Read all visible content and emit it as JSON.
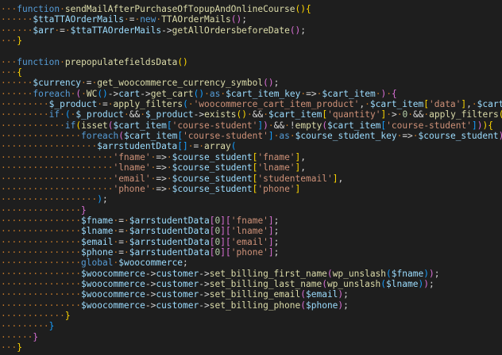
{
  "editor": {
    "lines": [
      [
        [
          "ws",
          "···"
        ],
        [
          "kw",
          "function"
        ],
        [
          "ws",
          "·"
        ],
        [
          "fn",
          "sendMailAfterPurchaseOfTopupAndOnlineCourse"
        ],
        [
          "p1",
          "(){"
        ]
      ],
      [
        [
          "ws",
          "······"
        ],
        [
          "var",
          "$ttaTTAOrderMails"
        ],
        [
          "ws",
          "·"
        ],
        [
          "op",
          "="
        ],
        [
          "ws",
          "·"
        ],
        [
          "kw",
          "new"
        ],
        [
          "ws",
          "·"
        ],
        [
          "fn",
          "TTAOrderMails"
        ],
        [
          "p2",
          "()"
        ],
        [
          "punc",
          ";"
        ]
      ],
      [
        [
          "ws",
          "······"
        ],
        [
          "var",
          "$arr"
        ],
        [
          "ws",
          "·"
        ],
        [
          "op",
          "="
        ],
        [
          "ws",
          "·"
        ],
        [
          "var",
          "$ttaTTAOrderMails"
        ],
        [
          "op",
          "->"
        ],
        [
          "fn",
          "getAllOrdersbeforeDate"
        ],
        [
          "p2",
          "()"
        ],
        [
          "punc",
          ";"
        ]
      ],
      [
        [
          "ws",
          "···"
        ],
        [
          "p1",
          "}"
        ]
      ],
      [
        [
          "ws",
          ""
        ]
      ],
      [
        [
          "ws",
          "···"
        ],
        [
          "kw",
          "function"
        ],
        [
          "ws",
          "·"
        ],
        [
          "fn",
          "prepopulatefieldsData"
        ],
        [
          "p1",
          "()"
        ]
      ],
      [
        [
          "ws",
          "···"
        ],
        [
          "p1",
          "{"
        ]
      ],
      [
        [
          "ws",
          "······"
        ],
        [
          "var",
          "$currency"
        ],
        [
          "ws",
          "·"
        ],
        [
          "op",
          "="
        ],
        [
          "ws",
          "·"
        ],
        [
          "fn",
          "get_woocommerce_currency_symbol"
        ],
        [
          "p2",
          "()"
        ],
        [
          "punc",
          ";"
        ]
      ],
      [
        [
          "ws",
          "······"
        ],
        [
          "kw",
          "foreach"
        ],
        [
          "ws",
          "·"
        ],
        [
          "p2",
          "("
        ],
        [
          "ws",
          "·"
        ],
        [
          "fn",
          "WC"
        ],
        [
          "p3",
          "()"
        ],
        [
          "op",
          "->"
        ],
        [
          "var",
          "cart"
        ],
        [
          "op",
          "->"
        ],
        [
          "fn",
          "get_cart"
        ],
        [
          "p3",
          "()"
        ],
        [
          "ws",
          "·"
        ],
        [
          "kw",
          "as"
        ],
        [
          "ws",
          "·"
        ],
        [
          "var",
          "$cart_item_key"
        ],
        [
          "ws",
          "·"
        ],
        [
          "op",
          "=>"
        ],
        [
          "ws",
          "·"
        ],
        [
          "var",
          "$cart_item"
        ],
        [
          "ws",
          "·"
        ],
        [
          "p2",
          ")"
        ],
        [
          "ws",
          "·"
        ],
        [
          "p2",
          "{"
        ]
      ],
      [
        [
          "ws",
          "·········"
        ],
        [
          "var",
          "$_product"
        ],
        [
          "ws",
          "·"
        ],
        [
          "op",
          "="
        ],
        [
          "ws",
          "·"
        ],
        [
          "fn",
          "apply_filters"
        ],
        [
          "p3",
          "("
        ],
        [
          "ws",
          "·"
        ],
        [
          "str",
          "'woocommerce_cart_item_product'"
        ],
        [
          "punc",
          ","
        ],
        [
          "ws",
          "·"
        ],
        [
          "var",
          "$cart_item"
        ],
        [
          "p1",
          "["
        ],
        [
          "str",
          "'data'"
        ],
        [
          "p1",
          "]"
        ],
        [
          "punc",
          ","
        ],
        [
          "ws",
          "·"
        ],
        [
          "var",
          "$cart_item"
        ],
        [
          "punc",
          ","
        ],
        [
          "ws",
          "·"
        ],
        [
          "var",
          "$cart"
        ]
      ],
      [
        [
          "ws",
          "·········"
        ],
        [
          "kw",
          "if"
        ],
        [
          "ws",
          "·"
        ],
        [
          "p3",
          "("
        ],
        [
          "ws",
          "·"
        ],
        [
          "var",
          "$_product"
        ],
        [
          "ws",
          "·"
        ],
        [
          "op",
          "&&"
        ],
        [
          "ws",
          "·"
        ],
        [
          "var",
          "$_product"
        ],
        [
          "op",
          "->"
        ],
        [
          "fn",
          "exists"
        ],
        [
          "p1",
          "()"
        ],
        [
          "ws",
          "·"
        ],
        [
          "op",
          "&&"
        ],
        [
          "ws",
          "·"
        ],
        [
          "var",
          "$cart_item"
        ],
        [
          "p1",
          "["
        ],
        [
          "str",
          "'quantity'"
        ],
        [
          "p1",
          "]"
        ],
        [
          "ws",
          "·"
        ],
        [
          "op",
          ">"
        ],
        [
          "ws",
          "·"
        ],
        [
          "num",
          "0"
        ],
        [
          "ws",
          "·"
        ],
        [
          "op",
          "&&"
        ],
        [
          "ws",
          "·"
        ],
        [
          "fn",
          "apply_filters"
        ],
        [
          "p1",
          "("
        ],
        [
          "ws",
          "·"
        ],
        [
          "str",
          "'woocommerce"
        ]
      ],
      [
        [
          "ws",
          "············"
        ],
        [
          "kw",
          "if"
        ],
        [
          "p1",
          "("
        ],
        [
          "fn",
          "isset"
        ],
        [
          "p2",
          "("
        ],
        [
          "var",
          "$cart_item"
        ],
        [
          "p3",
          "["
        ],
        [
          "str",
          "'course-student'"
        ],
        [
          "p3",
          "]"
        ],
        [
          "p2",
          ")"
        ],
        [
          "ws",
          "·"
        ],
        [
          "op",
          "&&"
        ],
        [
          "ws",
          "·"
        ],
        [
          "op",
          "!"
        ],
        [
          "fn",
          "empty"
        ],
        [
          "p2",
          "("
        ],
        [
          "var",
          "$cart_item"
        ],
        [
          "p3",
          "["
        ],
        [
          "str",
          "'course-student'"
        ],
        [
          "p3",
          "]"
        ],
        [
          "p2",
          ")"
        ],
        [
          "p1",
          "){"
        ]
      ],
      [
        [
          "ws",
          "···············"
        ],
        [
          "kw",
          "foreach"
        ],
        [
          "p2",
          "("
        ],
        [
          "var",
          "$cart_item"
        ],
        [
          "p3",
          "["
        ],
        [
          "str",
          "'course-student'"
        ],
        [
          "p3",
          "]"
        ],
        [
          "ws",
          "·"
        ],
        [
          "kw",
          "as"
        ],
        [
          "ws",
          "·"
        ],
        [
          "var",
          "$course_student_key"
        ],
        [
          "ws",
          "·"
        ],
        [
          "op",
          "=>"
        ],
        [
          "ws",
          "·"
        ],
        [
          "var",
          "$course_student"
        ],
        [
          "p2",
          ")"
        ],
        [
          "p2",
          "{"
        ]
      ],
      [
        [
          "ws",
          "··················"
        ],
        [
          "var",
          "$arrstudentData"
        ],
        [
          "p3",
          "[]"
        ],
        [
          "ws",
          "·"
        ],
        [
          "op",
          "="
        ],
        [
          "ws",
          "·"
        ],
        [
          "fn",
          "array"
        ],
        [
          "p3",
          "("
        ]
      ],
      [
        [
          "ws",
          "·····················"
        ],
        [
          "str",
          "'fname'"
        ],
        [
          "ws",
          "·"
        ],
        [
          "op",
          "=>"
        ],
        [
          "ws",
          "·"
        ],
        [
          "var",
          "$course_student"
        ],
        [
          "p1",
          "["
        ],
        [
          "str",
          "'fname'"
        ],
        [
          "p1",
          "]"
        ],
        [
          "punc",
          ","
        ]
      ],
      [
        [
          "ws",
          "·····················"
        ],
        [
          "str",
          "'lname'"
        ],
        [
          "ws",
          "·"
        ],
        [
          "op",
          "=>"
        ],
        [
          "ws",
          "·"
        ],
        [
          "var",
          "$course_student"
        ],
        [
          "p1",
          "["
        ],
        [
          "str",
          "'lname'"
        ],
        [
          "p1",
          "]"
        ],
        [
          "punc",
          ","
        ]
      ],
      [
        [
          "ws",
          "·····················"
        ],
        [
          "str",
          "'email'"
        ],
        [
          "ws",
          "·"
        ],
        [
          "op",
          "=>"
        ],
        [
          "ws",
          "·"
        ],
        [
          "var",
          "$course_student"
        ],
        [
          "p1",
          "["
        ],
        [
          "str",
          "'studentemail'"
        ],
        [
          "p1",
          "]"
        ],
        [
          "punc",
          ","
        ]
      ],
      [
        [
          "ws",
          "·····················"
        ],
        [
          "str",
          "'phone'"
        ],
        [
          "ws",
          "·"
        ],
        [
          "op",
          "=>"
        ],
        [
          "ws",
          "·"
        ],
        [
          "var",
          "$course_student"
        ],
        [
          "p1",
          "["
        ],
        [
          "str",
          "'phone'"
        ],
        [
          "p1",
          "]"
        ]
      ],
      [
        [
          "ws",
          "··················"
        ],
        [
          "p3",
          ")"
        ],
        [
          "punc",
          ";"
        ]
      ],
      [
        [
          "ws",
          "···············"
        ],
        [
          "p2",
          "}"
        ]
      ],
      [
        [
          "ws",
          "···············"
        ],
        [
          "var",
          "$fname"
        ],
        [
          "ws",
          "·"
        ],
        [
          "op",
          "="
        ],
        [
          "ws",
          "·"
        ],
        [
          "var",
          "$arrstudentData"
        ],
        [
          "p2",
          "["
        ],
        [
          "num",
          "0"
        ],
        [
          "p2",
          "]"
        ],
        [
          "p2",
          "["
        ],
        [
          "str",
          "'fname'"
        ],
        [
          "p2",
          "]"
        ],
        [
          "punc",
          ";"
        ]
      ],
      [
        [
          "ws",
          "···············"
        ],
        [
          "var",
          "$lname"
        ],
        [
          "ws",
          "·"
        ],
        [
          "op",
          "="
        ],
        [
          "ws",
          "·"
        ],
        [
          "var",
          "$arrstudentData"
        ],
        [
          "p2",
          "["
        ],
        [
          "num",
          "0"
        ],
        [
          "p2",
          "]"
        ],
        [
          "p2",
          "["
        ],
        [
          "str",
          "'lname'"
        ],
        [
          "p2",
          "]"
        ],
        [
          "punc",
          ";"
        ]
      ],
      [
        [
          "ws",
          "···············"
        ],
        [
          "var",
          "$email"
        ],
        [
          "ws",
          "·"
        ],
        [
          "op",
          "="
        ],
        [
          "ws",
          "·"
        ],
        [
          "var",
          "$arrstudentData"
        ],
        [
          "p2",
          "["
        ],
        [
          "num",
          "0"
        ],
        [
          "p2",
          "]"
        ],
        [
          "p2",
          "["
        ],
        [
          "str",
          "'email'"
        ],
        [
          "p2",
          "]"
        ],
        [
          "punc",
          ";"
        ]
      ],
      [
        [
          "ws",
          "···············"
        ],
        [
          "var",
          "$phone"
        ],
        [
          "ws",
          "·"
        ],
        [
          "op",
          "="
        ],
        [
          "ws",
          "·"
        ],
        [
          "var",
          "$arrstudentData"
        ],
        [
          "p2",
          "["
        ],
        [
          "num",
          "0"
        ],
        [
          "p2",
          "]"
        ],
        [
          "p2",
          "["
        ],
        [
          "str",
          "'phone'"
        ],
        [
          "p2",
          "]"
        ],
        [
          "punc",
          ";"
        ]
      ],
      [
        [
          "ws",
          "···············"
        ],
        [
          "kw",
          "global"
        ],
        [
          "ws",
          "·"
        ],
        [
          "var",
          "$woocommerce"
        ],
        [
          "punc",
          ";"
        ]
      ],
      [
        [
          "ws",
          "···············"
        ],
        [
          "var",
          "$woocommerce"
        ],
        [
          "op",
          "->"
        ],
        [
          "var",
          "customer"
        ],
        [
          "op",
          "->"
        ],
        [
          "fn",
          "set_billing_first_name"
        ],
        [
          "p2",
          "("
        ],
        [
          "fn",
          "wp_unslash"
        ],
        [
          "p3",
          "("
        ],
        [
          "var",
          "$fname"
        ],
        [
          "p3",
          ")"
        ],
        [
          "p2",
          ")"
        ],
        [
          "punc",
          ";"
        ]
      ],
      [
        [
          "ws",
          "···············"
        ],
        [
          "var",
          "$woocommerce"
        ],
        [
          "op",
          "->"
        ],
        [
          "var",
          "customer"
        ],
        [
          "op",
          "->"
        ],
        [
          "fn",
          "set_billing_last_name"
        ],
        [
          "p2",
          "("
        ],
        [
          "fn",
          "wp_unslash"
        ],
        [
          "p3",
          "("
        ],
        [
          "var",
          "$lname"
        ],
        [
          "p3",
          ")"
        ],
        [
          "p2",
          ")"
        ],
        [
          "punc",
          ";"
        ]
      ],
      [
        [
          "ws",
          "···············"
        ],
        [
          "var",
          "$woocommerce"
        ],
        [
          "op",
          "->"
        ],
        [
          "var",
          "customer"
        ],
        [
          "op",
          "->"
        ],
        [
          "fn",
          "set_billing_email"
        ],
        [
          "p2",
          "("
        ],
        [
          "var",
          "$email"
        ],
        [
          "p2",
          ")"
        ],
        [
          "punc",
          ";"
        ]
      ],
      [
        [
          "ws",
          "···············"
        ],
        [
          "var",
          "$woocommerce"
        ],
        [
          "op",
          "->"
        ],
        [
          "var",
          "customer"
        ],
        [
          "op",
          "->"
        ],
        [
          "fn",
          "set_billing_phone"
        ],
        [
          "p2",
          "("
        ],
        [
          "var",
          "$phone"
        ],
        [
          "p2",
          ")"
        ],
        [
          "punc",
          ";"
        ]
      ],
      [
        [
          "ws",
          "············"
        ],
        [
          "p1",
          "}"
        ]
      ],
      [
        [
          "ws",
          "·········"
        ],
        [
          "p3",
          "}"
        ]
      ],
      [
        [
          "ws",
          "······"
        ],
        [
          "p2",
          "}"
        ]
      ],
      [
        [
          "ws",
          "···"
        ],
        [
          "p1",
          "}"
        ]
      ]
    ]
  }
}
